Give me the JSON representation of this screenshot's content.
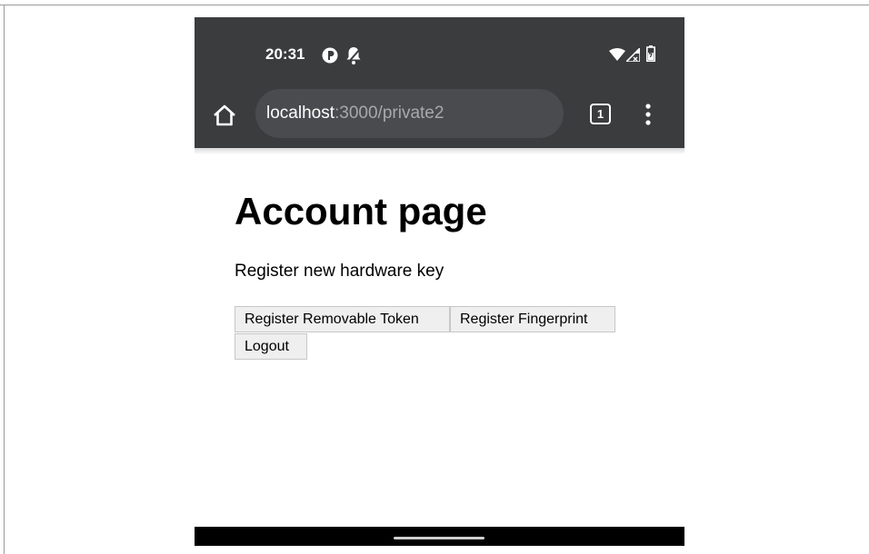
{
  "status_bar": {
    "time": "20:31",
    "left_icons": [
      "notification-icon",
      "bell-icon"
    ],
    "right_icons": [
      "wifi-icon",
      "signal-icon",
      "battery-icon"
    ]
  },
  "browser": {
    "url_host": "localhost",
    "url_rest": ":3000/private2",
    "tab_count": "1"
  },
  "page": {
    "title": "Account page",
    "subtitle": "Register new hardware key",
    "buttons": {
      "register_removable_token": "Register Removable Token",
      "register_fingerprint": "Register Fingerprint",
      "logout": "Logout"
    }
  },
  "colors": {
    "chrome_bar": "#3b3c3e",
    "omnibox": "#4a4b4e",
    "button_bg": "#efefef"
  }
}
